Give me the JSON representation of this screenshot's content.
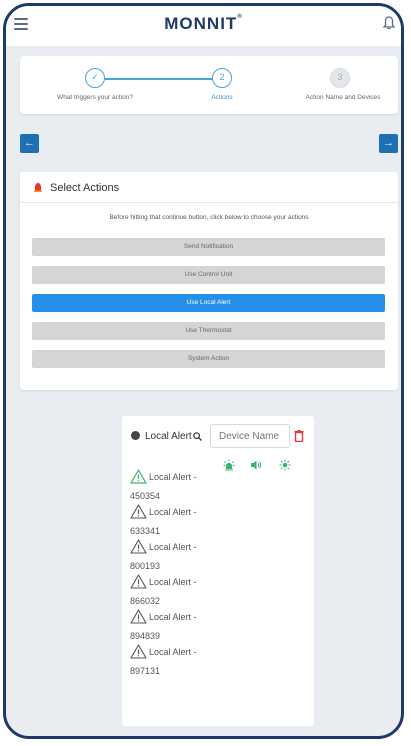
{
  "header": {
    "logo_text": "MONNIT",
    "logo_tm": "®"
  },
  "steps": [
    {
      "label": "What triggers your action?",
      "symbol": "✓",
      "state": "done"
    },
    {
      "label": "Actions",
      "symbol": "2",
      "state": "active"
    },
    {
      "label": "Action Name and Devices",
      "symbol": "3",
      "state": "inactive"
    }
  ],
  "nav": {
    "back": "←",
    "forward": "→"
  },
  "actions": {
    "title": "Select Actions",
    "description": "Before hitting that continue button, click below to choose your actions",
    "options": [
      {
        "label": "Send Notification",
        "selected": false
      },
      {
        "label": "Use Control Unit",
        "selected": false
      },
      {
        "label": "Use Local Alert",
        "selected": true
      },
      {
        "label": "Use Thermostat",
        "selected": false
      },
      {
        "label": "System Action",
        "selected": false
      }
    ]
  },
  "devices": {
    "tab_label": "Local Alert",
    "search_placeholder": "Device Name",
    "items": [
      {
        "name": "Local Alert -",
        "number": "450354",
        "status": "active"
      },
      {
        "name": "Local Alert -",
        "number": "633341",
        "status": "inactive"
      },
      {
        "name": "Local Alert -",
        "number": "800193",
        "status": "inactive"
      },
      {
        "name": "Local Alert -",
        "number": "866032",
        "status": "inactive"
      },
      {
        "name": "Local Alert -",
        "number": "894839",
        "status": "inactive"
      },
      {
        "name": "Local Alert -",
        "number": "897131",
        "status": "inactive"
      }
    ],
    "controls": [
      "light-icon",
      "sound-icon",
      "flash-icon"
    ]
  },
  "colors": {
    "accent": "#2490e8",
    "brand": "#1f3a66",
    "success": "#3cb371",
    "danger": "#e53935"
  }
}
